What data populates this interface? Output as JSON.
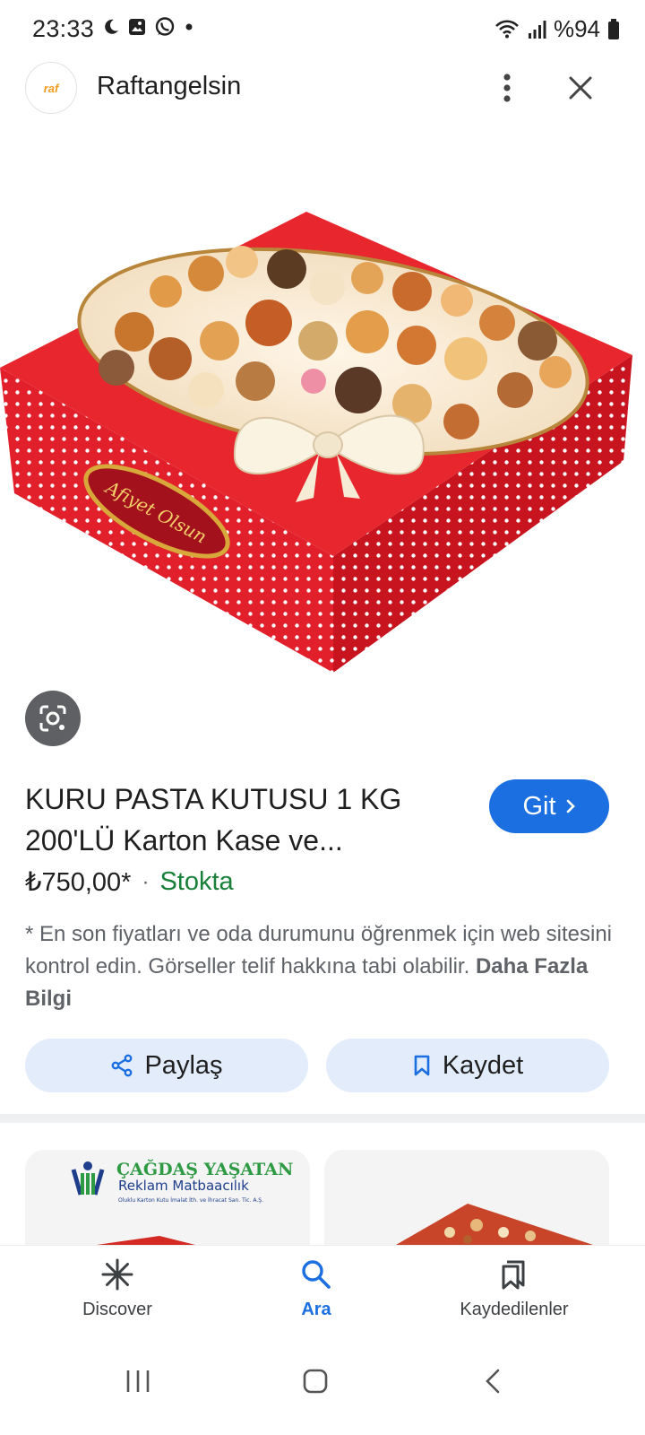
{
  "status_bar": {
    "time": "23:33",
    "icons": [
      "moon-icon",
      "gallery-icon",
      "whatsapp-icon",
      "dot-icon",
      "wifi-icon",
      "signal-icon",
      "battery-icon"
    ],
    "battery": "%94"
  },
  "header": {
    "logo_text": "raf",
    "site_name": "Raftangelsin"
  },
  "product": {
    "title": "KURU PASTA KUTUSU 1 KG 200'LÜ Karton Kase ve...",
    "go_label": "Git",
    "price": "₺750,00*",
    "separator": "·",
    "stock": "Stokta",
    "disclaimer": "* En son fiyatları ve oda durumunu öğrenmek için web sitesini kontrol edin. Görseller telif hakkına tabi olabilir.",
    "more_info": "Daha Fazla Bilgi"
  },
  "actions": {
    "share_label": "Paylaş",
    "save_label": "Kaydet"
  },
  "related": {
    "card1_brand": "ÇAĞDAŞ YAŞATAN",
    "card1_sub": "Reklam Matbaacılık",
    "card1_small": "Oluklu Karton Kutu İmalat İth. ve İhracat San. Tic. A.Ş."
  },
  "bottom_nav": {
    "discover": "Discover",
    "search": "Ara",
    "saved": "Kaydedilenler"
  },
  "box_label": "Afiyet Olsun",
  "colors": {
    "accent": "#1b6fe0",
    "stock": "#188038",
    "button_bg": "#e3ecfa",
    "box_red": "#e2202c"
  }
}
